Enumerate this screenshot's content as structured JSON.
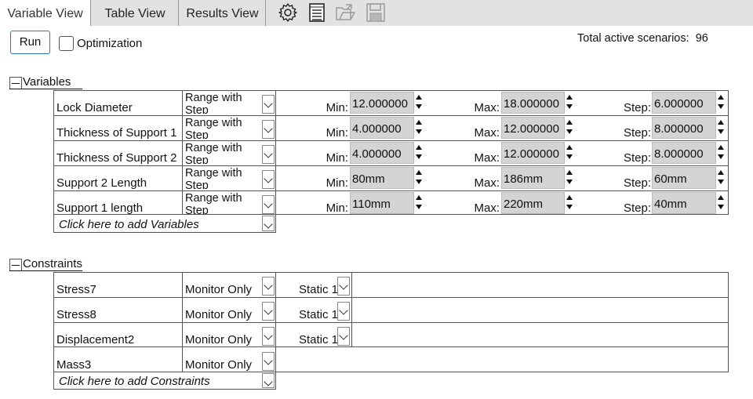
{
  "tabs": [
    {
      "label": "Variable View",
      "active": true
    },
    {
      "label": "Table View",
      "active": false
    },
    {
      "label": "Results View",
      "active": false
    }
  ],
  "toolbar_icons": [
    "gear-icon",
    "list-icon",
    "open-folder-icon",
    "save-icon"
  ],
  "run_label": "Run",
  "optimization": {
    "label": "Optimization",
    "checked": false
  },
  "total_active": {
    "label": "Total active scenarios:",
    "value": "96"
  },
  "variables": {
    "title": "Variables",
    "rows": [
      {
        "name": "Lock Diameter",
        "type": "Range with Step",
        "min_label": "Min:",
        "min": "12.000000",
        "max_label": "Max:",
        "max": "18.000000",
        "step_label": "Step:",
        "step": "6.000000"
      },
      {
        "name": "Thickness of Support 1",
        "type": "Range with Step",
        "min_label": "Min:",
        "min": "4.000000",
        "max_label": "Max:",
        "max": "12.000000",
        "step_label": "Step:",
        "step": "8.000000"
      },
      {
        "name": "Thickness of Support 2",
        "type": "Range with Step",
        "min_label": "Min:",
        "min": "4.000000",
        "max_label": "Max:",
        "max": "12.000000",
        "step_label": "Step:",
        "step": "8.000000"
      },
      {
        "name": "Support 2 Length",
        "type": "Range with Step",
        "min_label": "Min:",
        "min": "80mm",
        "max_label": "Max:",
        "max": "186mm",
        "step_label": "Step:",
        "step": "60mm"
      },
      {
        "name": "Support 1 length",
        "type": "Range with Step",
        "min_label": "Min:",
        "min": "110mm",
        "max_label": "Max:",
        "max": "220mm",
        "step_label": "Step:",
        "step": "40mm"
      }
    ],
    "add_label": "Click here to add Variables"
  },
  "constraints": {
    "title": "Constraints",
    "rows": [
      {
        "name": "Stress7",
        "type": "Monitor Only",
        "study": "Static 1"
      },
      {
        "name": "Stress8",
        "type": "Monitor Only",
        "study": "Static 1"
      },
      {
        "name": "Displacement2",
        "type": "Monitor Only",
        "study": "Static 1"
      },
      {
        "name": "Mass3",
        "type": "Monitor Only",
        "study": ""
      }
    ],
    "add_label": "Click here to add Constraints"
  },
  "colors": {
    "tab_bar": "#e2e2e2",
    "value_field": "#d4d4d4",
    "run_border": "#2f74c0"
  }
}
